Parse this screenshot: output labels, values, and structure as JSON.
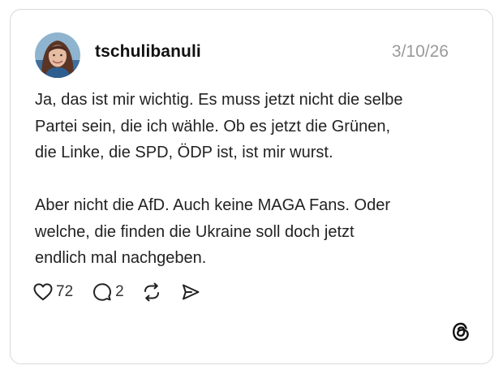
{
  "post": {
    "username": "tschulibanuli",
    "date": "3/10/26",
    "paragraphs": [
      "Ja, das ist mir wichtig. Es muss jetzt nicht die selbe\nPartei sein, die ich wähle. Ob es jetzt die Grünen,\ndie Linke, die SPD, ÖDP ist, ist mir wurst.",
      "Aber nicht die AfD. Auch keine MAGA Fans. Oder\nwelche, die finden die Ukraine soll doch jetzt\nendlich mal nachgeben."
    ],
    "likes": "72",
    "replies": "2"
  },
  "icons": {
    "like": "heart-icon",
    "reply": "speech-bubble-icon",
    "repost": "repost-icon",
    "share": "send-icon",
    "brand": "threads-logo-icon"
  }
}
